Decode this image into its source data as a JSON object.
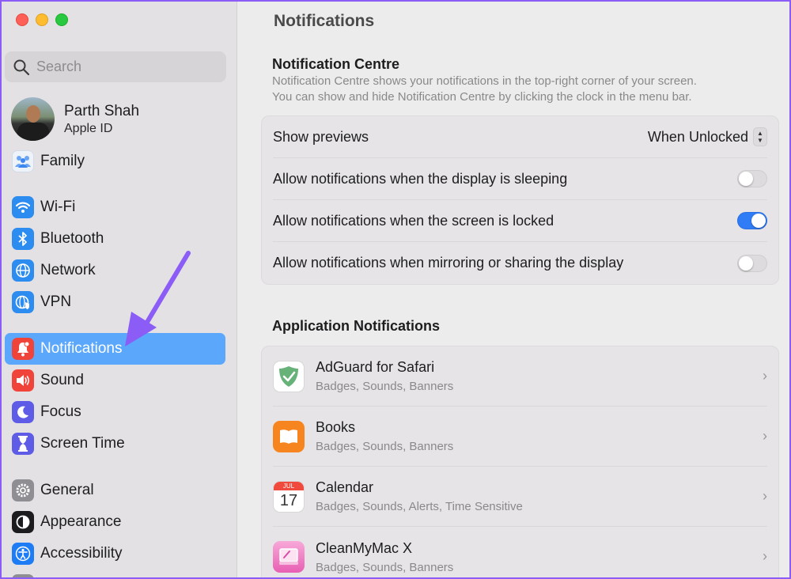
{
  "window": {
    "title": "Notifications"
  },
  "sidebar": {
    "search_placeholder": "Search",
    "profile": {
      "name": "Parth Shah",
      "subtitle": "Apple ID"
    },
    "items": [
      {
        "label": "Family",
        "icon": "family-icon",
        "color": "#e9eef7"
      },
      {
        "label": "Wi-Fi",
        "icon": "wifi-icon",
        "color": "#2d8cf0"
      },
      {
        "label": "Bluetooth",
        "icon": "bluetooth-icon",
        "color": "#2d8cf0"
      },
      {
        "label": "Network",
        "icon": "globe-icon",
        "color": "#2d8cf0"
      },
      {
        "label": "VPN",
        "icon": "vpn-globe-icon",
        "color": "#2d8cf0"
      },
      {
        "label": "Notifications",
        "icon": "bell-icon",
        "color": "#f0443a",
        "active": true
      },
      {
        "label": "Sound",
        "icon": "speaker-icon",
        "color": "#f0443a"
      },
      {
        "label": "Focus",
        "icon": "moon-icon",
        "color": "#5e5ce6"
      },
      {
        "label": "Screen Time",
        "icon": "hourglass-icon",
        "color": "#5e5ce6"
      },
      {
        "label": "General",
        "icon": "gear-icon",
        "color": "#8e8e93"
      },
      {
        "label": "Appearance",
        "icon": "appearance-icon",
        "color": "#1c1c1e"
      },
      {
        "label": "Accessibility",
        "icon": "accessibility-icon",
        "color": "#1e7cf5"
      }
    ]
  },
  "notification_centre": {
    "title": "Notification Centre",
    "description_line1": "Notification Centre shows your notifications in the top-right corner of your screen.",
    "description_line2": "You can show and hide Notification Centre by clicking the clock in the menu bar.",
    "show_previews_label": "Show previews",
    "show_previews_value": "When Unlocked",
    "toggles": [
      {
        "label": "Allow notifications when the display is sleeping",
        "on": false
      },
      {
        "label": "Allow notifications when the screen is locked",
        "on": true
      },
      {
        "label": "Allow notifications when mirroring or sharing the display",
        "on": false
      }
    ]
  },
  "application_notifications": {
    "title": "Application Notifications",
    "apps": [
      {
        "name": "AdGuard for Safari",
        "detail": "Badges, Sounds, Banners",
        "icon": "adguard-icon"
      },
      {
        "name": "Books",
        "detail": "Badges, Sounds, Banners",
        "icon": "books-icon"
      },
      {
        "name": "Calendar",
        "detail": "Badges, Sounds, Alerts, Time Sensitive",
        "icon": "calendar-icon",
        "cal_month": "JUL",
        "cal_day": "17"
      },
      {
        "name": "CleanMyMac X",
        "detail": "Badges, Sounds, Banners",
        "icon": "cleanmymac-icon"
      }
    ]
  },
  "colors": {
    "accent": "#2f7cf6",
    "sidebar_selection": "#5aa7fb",
    "annotation_arrow": "#8b5cf6"
  }
}
